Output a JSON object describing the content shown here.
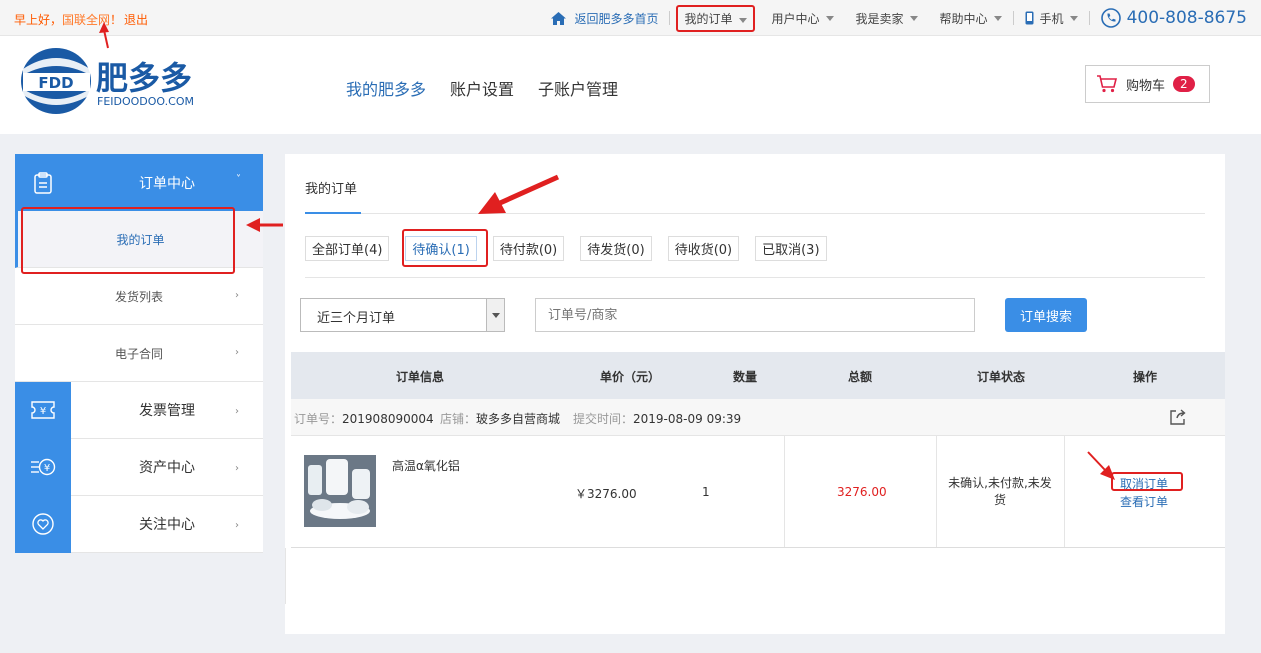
{
  "topbar": {
    "greeting": "早上好，",
    "user": "国联全网",
    "exclaim": "！",
    "logout": "退出",
    "home_link": "返回肥多多首页",
    "my_orders": "我的订单",
    "user_center": "用户中心",
    "seller": "我是卖家",
    "help": "帮助中心",
    "mobile": "手机",
    "phone": "400-808-8675"
  },
  "header": {
    "logo_mark": "FDD",
    "logo_cn": "肥多多",
    "logo_en": "FEIDOODOO.COM",
    "nav": [
      "我的肥多多",
      "账户设置",
      "子账户管理"
    ],
    "cart_label": "购物车",
    "cart_count": "2"
  },
  "sidebar": {
    "order_center": "订单中心",
    "sub_items": [
      "我的订单",
      "发货列表",
      "电子合同"
    ],
    "sections": [
      {
        "label": "发票管理",
        "icon": "invoice-icon"
      },
      {
        "label": "资产中心",
        "icon": "asset-icon"
      },
      {
        "label": "关注中心",
        "icon": "heart-icon"
      }
    ]
  },
  "main": {
    "title": "我的订单",
    "tabs": [
      "全部订单(4)",
      "待确认(1)",
      "待付款(0)",
      "待发货(0)",
      "待收货(0)",
      "已取消(3)"
    ],
    "filter_value": "近三个月订单",
    "search_placeholder": "订单号/商家",
    "search_button": "订单搜索",
    "columns": [
      "订单信息",
      "单价（元）",
      "数量",
      "总额",
      "订单状态",
      "操作"
    ],
    "order": {
      "no_label": "订单号：",
      "no": "201908090004",
      "shop_label": "店铺：",
      "shop": "玻多多自营商城",
      "time_label": "提交时间：",
      "time": "2019-08-09 09:39",
      "product": "高温α氧化铝",
      "price": "￥3276.00",
      "qty": "1",
      "total": "3276.00",
      "status": "未确认,未付款,未发货",
      "action_cancel": "取消订单",
      "action_view": "查看订单"
    }
  },
  "colors": {
    "accent": "#3a8ee6",
    "annotation": "#e02020",
    "total": "#e02020"
  }
}
